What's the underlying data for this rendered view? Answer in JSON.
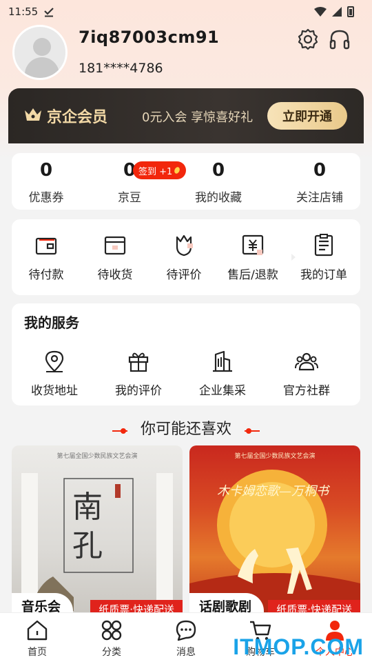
{
  "status_bar": {
    "time": "11:55"
  },
  "profile": {
    "username": "7iq87003cm91",
    "phone": "181****4786"
  },
  "vip": {
    "title": "京企会员",
    "desc": "0元入会 享惊喜好礼",
    "button": "立即开通"
  },
  "stats": {
    "signin_badge": "签到 +1",
    "items": [
      {
        "value": "0",
        "label": "优惠券"
      },
      {
        "value": "0",
        "label": "京豆"
      },
      {
        "value": "0",
        "label": "我的收藏"
      },
      {
        "value": "0",
        "label": "关注店铺"
      }
    ]
  },
  "orders": {
    "items": [
      {
        "label": "待付款",
        "icon": "wallet-icon"
      },
      {
        "label": "待收货",
        "icon": "box-icon"
      },
      {
        "label": "待评价",
        "icon": "review-icon"
      },
      {
        "label": "售后/退款",
        "icon": "refund-icon"
      },
      {
        "label": "我的订单",
        "icon": "order-list-icon"
      }
    ]
  },
  "services": {
    "title": "我的服务",
    "items": [
      {
        "label": "收货地址",
        "icon": "location-icon"
      },
      {
        "label": "我的评价",
        "icon": "gift-icon"
      },
      {
        "label": "企业集采",
        "icon": "building-icon"
      },
      {
        "label": "官方社群",
        "icon": "community-icon"
      }
    ]
  },
  "recommend": {
    "title": "你可能还喜欢",
    "products": [
      {
        "tag": "音乐会",
        "subtag": "纸质票·快递配送",
        "poster_text": "南孔",
        "poster_caption": "第七届全国少数民族文艺会演"
      },
      {
        "tag": "话剧歌剧",
        "subtag": "纸质票·快递配送",
        "poster_text": "木卡姆恋歌—万桐书",
        "poster_caption": "第七届全国少数民族文艺会演"
      }
    ]
  },
  "tabbar": {
    "items": [
      {
        "label": "首页",
        "icon": "home-icon"
      },
      {
        "label": "分类",
        "icon": "category-icon"
      },
      {
        "label": "消息",
        "icon": "message-icon"
      },
      {
        "label": "购物车",
        "icon": "cart-icon"
      },
      {
        "label": "个人中心",
        "icon": "profile-icon"
      }
    ],
    "active_index": 4
  },
  "watermark": "ITMOP.COM",
  "colors": {
    "accent": "#f2270c",
    "vip_gold": "#f3d9a6",
    "vip_dark": "#2b2724"
  }
}
